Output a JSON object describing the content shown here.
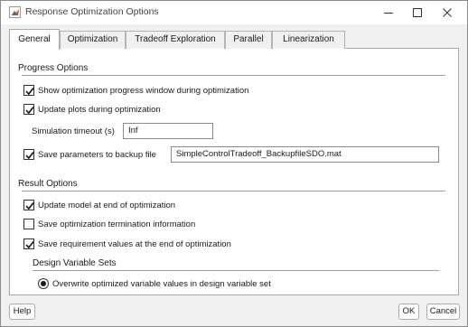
{
  "window": {
    "title": "Response Optimization Options",
    "icon": "matlab-icon",
    "controls": [
      "minimize-icon",
      "maximize-icon",
      "close-icon"
    ]
  },
  "tabs": [
    {
      "label": "General",
      "active": true
    },
    {
      "label": "Optimization",
      "active": false
    },
    {
      "label": "Tradeoff Exploration",
      "active": false
    },
    {
      "label": "Parallel",
      "active": false
    },
    {
      "label": "Linearization",
      "active": false
    }
  ],
  "progress": {
    "title": "Progress Options",
    "show_progress": {
      "label": "Show optimization progress window during optimization",
      "checked": true
    },
    "update_plots": {
      "label": "Update plots during optimization",
      "checked": true
    },
    "timeout": {
      "label": "Simulation timeout (s)",
      "value": "Inf"
    },
    "save_params": {
      "label": "Save parameters to backup file",
      "checked": true,
      "value": "SimpleControlTradeoff_BackupfileSDO.mat"
    }
  },
  "result": {
    "title": "Result Options",
    "update_model": {
      "label": "Update model at end of optimization",
      "checked": true
    },
    "save_termination": {
      "label": "Save optimization termination information",
      "checked": false
    },
    "save_requirements": {
      "label": "Save requirement values at the end of optimization",
      "checked": true
    }
  },
  "design_sets": {
    "title": "Design Variable Sets",
    "overwrite": {
      "label": "Overwrite optimized variable values in design variable set",
      "selected": true
    }
  },
  "buttons": {
    "help": "Help",
    "ok": "OK",
    "cancel": "Cancel"
  }
}
